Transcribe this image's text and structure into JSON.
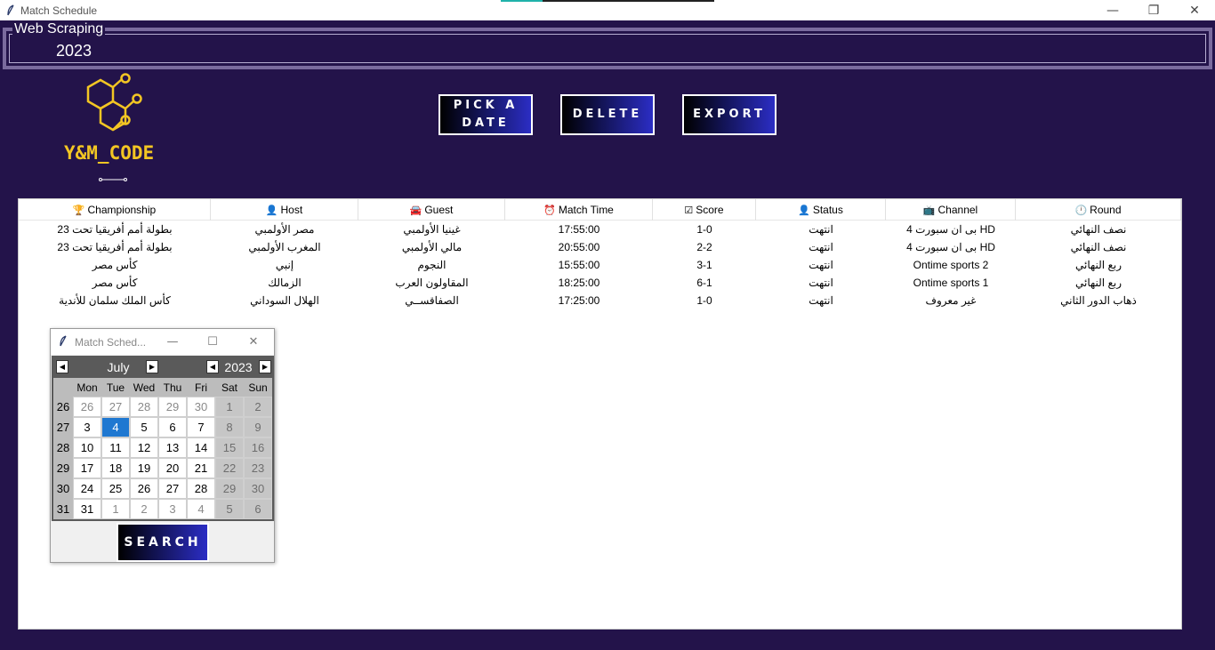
{
  "window": {
    "title": "Match Schedule",
    "minimize": "—",
    "restore": "❐",
    "close": "✕"
  },
  "header": {
    "label": "Web Scraping",
    "year": "2023"
  },
  "logo": {
    "text": "Y&M_CODE",
    "color": "#f3c623"
  },
  "buttons": {
    "pick_date": "PICK A DATE",
    "delete": "DELETE",
    "export": "EXPORT",
    "search": "SEARCH"
  },
  "table": {
    "columns": [
      {
        "label": "Championship",
        "icon": "🏆"
      },
      {
        "label": "Host",
        "icon": "👤"
      },
      {
        "label": "Guest",
        "icon": "🚘"
      },
      {
        "label": "Match Time",
        "icon": "⏰"
      },
      {
        "label": "Score",
        "icon": "☑"
      },
      {
        "label": "Status",
        "icon": "👤"
      },
      {
        "label": "Channel",
        "icon": "📺"
      },
      {
        "label": "Round",
        "icon": "🕛"
      }
    ],
    "rows": [
      [
        "بطولة أمم أفريقيا تحت 23",
        "مصر الأولمبي",
        "غينيا الأولمبي",
        "17:55:00",
        "1-0",
        "انتهت",
        "بى ان سبورت 4 HD",
        "نصف النهائي"
      ],
      [
        "بطولة أمم أفريقيا تحت 23",
        "المغرب الأولمبي",
        "مالي الأولمبي",
        "20:55:00",
        "2-2",
        "انتهت",
        "بى ان سبورت 4 HD",
        "نصف النهائي"
      ],
      [
        "كأس مصر",
        "إنبي",
        "النجوم",
        "15:55:00",
        "3-1",
        "انتهت",
        "Ontime sports 2",
        "ربع النهائي"
      ],
      [
        "كأس مصر",
        "الزمالك",
        "المقاولون العرب",
        "18:25:00",
        "6-1",
        "انتهت",
        "Ontime sports 1",
        "ربع النهائي"
      ],
      [
        "كأس الملك سلمان للأندية",
        "الهلال السوداني",
        "الصفاقســي",
        "17:25:00",
        "1-0",
        "انتهت",
        "غير معروف",
        "ذهاب الدور الثاني"
      ]
    ]
  },
  "calendar_dialog": {
    "title": "Match Sched...",
    "minimize": "—",
    "maximize": "☐",
    "close": "✕",
    "month": "July",
    "year": "2023",
    "weekdays": [
      "Mon",
      "Tue",
      "Wed",
      "Thu",
      "Fri",
      "Sat",
      "Sun"
    ],
    "weeks": [
      {
        "no": "26",
        "days": [
          "26",
          "27",
          "28",
          "29",
          "30",
          "1",
          "2"
        ]
      },
      {
        "no": "27",
        "days": [
          "3",
          "4",
          "5",
          "6",
          "7",
          "8",
          "9"
        ]
      },
      {
        "no": "28",
        "days": [
          "10",
          "11",
          "12",
          "13",
          "14",
          "15",
          "16"
        ]
      },
      {
        "no": "29",
        "days": [
          "17",
          "18",
          "19",
          "20",
          "21",
          "22",
          "23"
        ]
      },
      {
        "no": "30",
        "days": [
          "24",
          "25",
          "26",
          "27",
          "28",
          "29",
          "30"
        ]
      },
      {
        "no": "31",
        "days": [
          "31",
          "1",
          "2",
          "3",
          "4",
          "5",
          "6"
        ]
      }
    ],
    "selected_day": "4",
    "selected_color": "#1f78d1"
  }
}
